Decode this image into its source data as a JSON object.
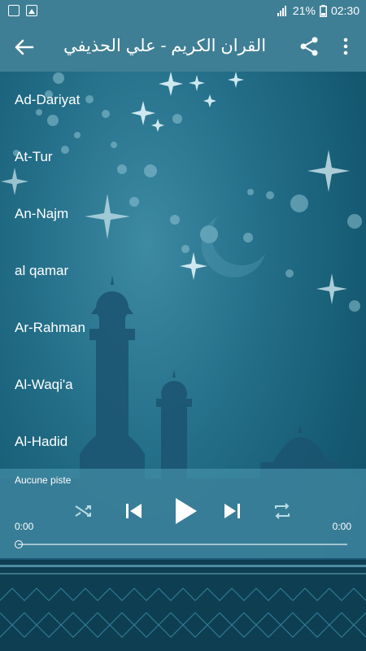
{
  "status_bar": {
    "battery_percent": "21%",
    "time": "02:30"
  },
  "app_bar": {
    "title": "القران الكريم - علي الحذيفي"
  },
  "tracks": [
    {
      "label": "Ad-Dariyat"
    },
    {
      "label": "At-Tur"
    },
    {
      "label": "An-Najm"
    },
    {
      "label": "al qamar"
    },
    {
      "label": "Ar-Rahman"
    },
    {
      "label": "Al-Waqi'a"
    },
    {
      "label": "Al-Hadid"
    }
  ],
  "player": {
    "track_name": "Aucune piste",
    "time_current": "0:00",
    "time_total": "0:00",
    "progress": 0
  },
  "colors": {
    "app_bar": "#3f7f95",
    "background": "#1f6a84",
    "mosque_silhouette": "#1b5470"
  }
}
